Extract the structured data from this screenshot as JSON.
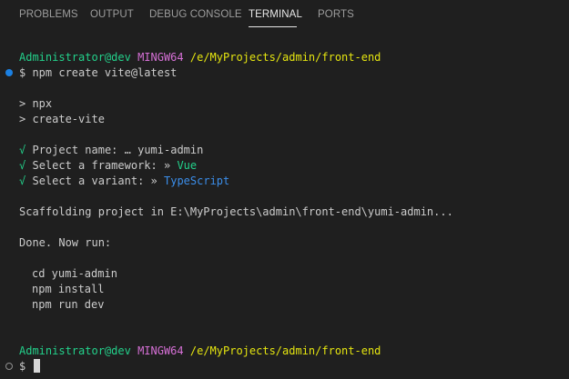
{
  "panel_tabs": [
    {
      "label": "PROBLEMS"
    },
    {
      "label": "OUTPUT"
    },
    {
      "label": "DEBUG CONSOLE"
    },
    {
      "label": "TERMINAL",
      "active": true
    },
    {
      "label": "PORTS"
    }
  ],
  "terminal": {
    "prompt1": {
      "user": "Administrator@dev",
      "env": "MINGW64",
      "path": "/e/MyProjects/admin/front-end"
    },
    "command": "$ npm create vite@latest",
    "npx_lines": [
      "> npx",
      "> create-vite"
    ],
    "answers": [
      {
        "check": "√",
        "question": "Project name:",
        "sep": "…",
        "value": "yumi-admin"
      },
      {
        "check": "√",
        "question": "Select a framework:",
        "sep": "»",
        "value": "Vue"
      },
      {
        "check": "√",
        "question": "Select a variant:",
        "sep": "»",
        "value": "TypeScript"
      }
    ],
    "scaffolding": "Scaffolding project in E:\\MyProjects\\admin\\front-end\\yumi-admin...",
    "done": "Done. Now run:",
    "next_steps": [
      "cd yumi-admin",
      "npm install",
      "npm run dev"
    ],
    "prompt2": {
      "user": "Administrator@dev",
      "env": "MINGW64",
      "path": "/e/MyProjects/admin/front-end"
    },
    "input_prompt": "$ "
  },
  "colors": {
    "background": "#1f1f1f",
    "user": "#23d18b",
    "env": "#d670d6",
    "path": "#e5e510",
    "answer_vue": "#23d18b",
    "answer_ts": "#3b8eea",
    "command_decoration": "#1b80e2"
  }
}
